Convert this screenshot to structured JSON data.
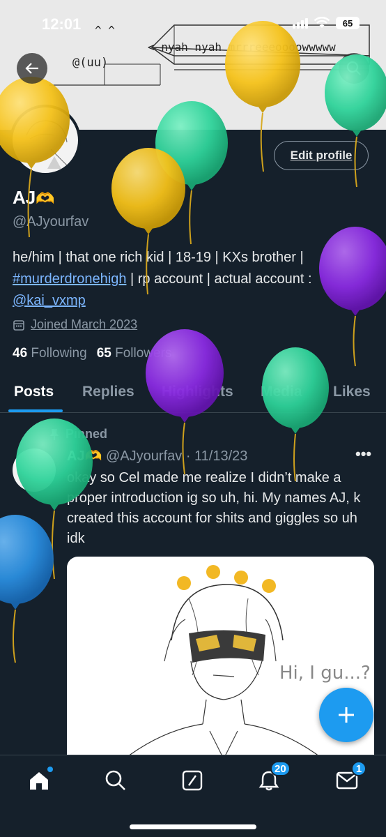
{
  "status_bar": {
    "time": "12:01",
    "battery": "65"
  },
  "banner": {
    "cat_ears": "^ ^",
    "cat_face": "@(uu)",
    "speech": "< nyah nyah mrrreeeoooowwwww"
  },
  "profile": {
    "name": "AJ",
    "name_emoji": "🫶",
    "handle": "@AJyourfav",
    "edit_label": "Edit profile",
    "bio_part1": "he/him | that one rich kid | 18-19 | KXs brother | ",
    "bio_hashtag": "#murderdronehigh",
    "bio_part2": " | rp account | actual account : ",
    "bio_mention": "@kai_vxmp",
    "joined": "Joined March 2023",
    "following_count": "46",
    "following_label": "Following",
    "followers_count": "65",
    "followers_label": "Followers"
  },
  "tabs": [
    {
      "label": "Posts",
      "active": true
    },
    {
      "label": "Replies",
      "active": false
    },
    {
      "label": "Highlights",
      "active": false
    },
    {
      "label": "Media",
      "active": false
    },
    {
      "label": "Likes",
      "active": false
    }
  ],
  "post": {
    "pinned_label": "Pinned",
    "author_name": "AJ🫶",
    "author_handle": "@AJyourfav",
    "separator": " · ",
    "date": "11/13/23",
    "more": "•••",
    "text": "okay so Cel made me realize I didn’t make a proper introduction ig so uh, hi. My names AJ, k created this account for shits and giggles so uh idk",
    "image_text": "Hi, I gu...?"
  },
  "nav": {
    "notifications_badge": "20",
    "messages_badge": "1"
  },
  "colors": {
    "background": "#15202b",
    "accent": "#1d9bf0",
    "link": "#7cb6ff",
    "secondary_text": "#8b98a5",
    "balloon_yellow": "#f5c21a",
    "balloon_green": "#2fd39a",
    "balloon_purple": "#8a2be2",
    "balloon_blue": "#2b8fe0"
  },
  "icons": [
    "back-arrow-icon",
    "search-icon",
    "calendar-icon",
    "pin-icon",
    "plus-icon",
    "home-icon",
    "search-nav-icon",
    "compose-icon",
    "bell-icon",
    "mail-icon"
  ]
}
